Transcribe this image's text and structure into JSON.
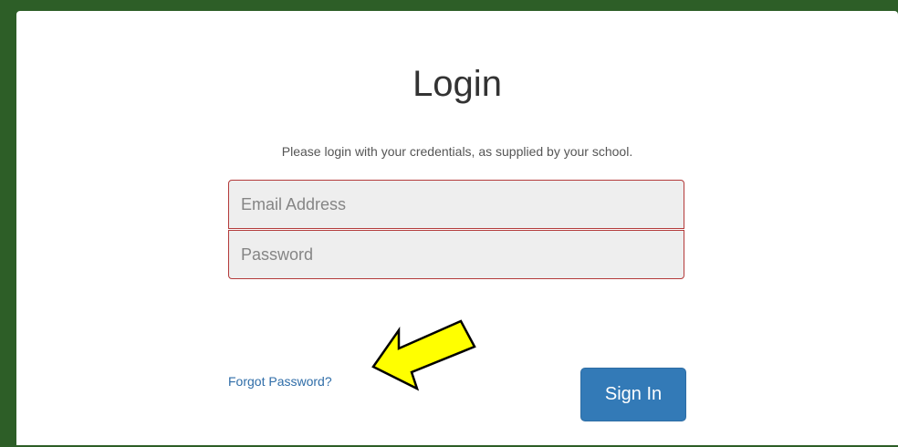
{
  "login": {
    "title": "Login",
    "subtitle": "Please login with your credentials, as supplied by your school.",
    "email_placeholder": "Email Address",
    "password_placeholder": "Password",
    "forgot_password": "Forgot Password?",
    "sign_in": "Sign In"
  },
  "colors": {
    "background": "#2d5e27",
    "card": "#ffffff",
    "field_border": "#b33a3a",
    "field_bg": "#eeeeee",
    "link": "#2f6da8",
    "button": "#337ab7",
    "annotation_arrow": "#ffff00"
  },
  "annotation": {
    "icon": "yellow-pointer-arrow",
    "points_to": "forgot-password-link"
  }
}
